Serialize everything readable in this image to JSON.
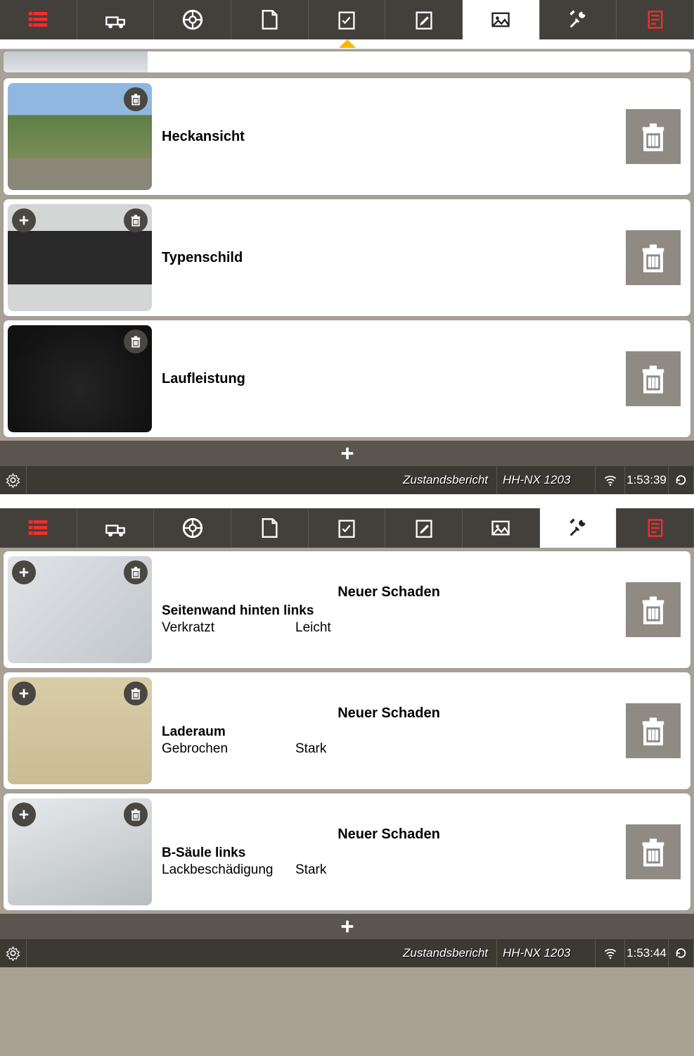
{
  "tabs": [
    {
      "icon": "list-icon",
      "active": false,
      "red": true
    },
    {
      "icon": "truck-icon",
      "active": false
    },
    {
      "icon": "wheel-icon",
      "active": false
    },
    {
      "icon": "doc-icon",
      "active": false
    },
    {
      "icon": "form-check-icon",
      "active": false
    },
    {
      "icon": "form-edit-icon",
      "active": false
    },
    {
      "icon": "photo-icon",
      "active": true
    },
    {
      "icon": "tools-icon",
      "active": false
    },
    {
      "icon": "report-icon",
      "active": false,
      "red": true
    }
  ],
  "photos": [
    {
      "label": "Heckansicht",
      "thumb_style": "thumb-bg-road",
      "has_add": false
    },
    {
      "label": "Typenschild",
      "thumb_style": "thumb-bg-plate",
      "has_add": true
    },
    {
      "label": "Laufleistung",
      "thumb_style": "thumb-bg-dash",
      "has_add": false
    }
  ],
  "status": {
    "title": "Zustandsbericht",
    "plate": "HH-NX 1203",
    "time": "1:53:39"
  },
  "tabs2": [
    {
      "icon": "list-icon",
      "active": false,
      "red": true
    },
    {
      "icon": "truck-icon",
      "active": false
    },
    {
      "icon": "wheel-icon",
      "active": false
    },
    {
      "icon": "doc-icon",
      "active": false
    },
    {
      "icon": "form-check-icon",
      "active": false
    },
    {
      "icon": "form-edit-icon",
      "active": false
    },
    {
      "icon": "photo-icon",
      "active": false
    },
    {
      "icon": "tools-icon",
      "active": true
    },
    {
      "icon": "report-icon",
      "active": false,
      "red": true
    }
  ],
  "damages": [
    {
      "header": "Neuer Schaden",
      "location": "Seitenwand hinten links",
      "type": "Verkratzt",
      "severity": "Leicht",
      "thumb_style": "thumb-bg-metal"
    },
    {
      "header": "Neuer Schaden",
      "location": "Laderaum",
      "type": "Gebrochen",
      "severity": "Stark",
      "thumb_style": "thumb-bg-wood"
    },
    {
      "header": "Neuer Schaden",
      "location": "B-Säule links",
      "type": "Lackbeschädigung",
      "severity": "Stark",
      "thumb_style": "thumb-bg-panel"
    }
  ],
  "status2": {
    "title": "Zustandsbericht",
    "plate": "HH-NX 1203",
    "time": "1:53:44"
  }
}
